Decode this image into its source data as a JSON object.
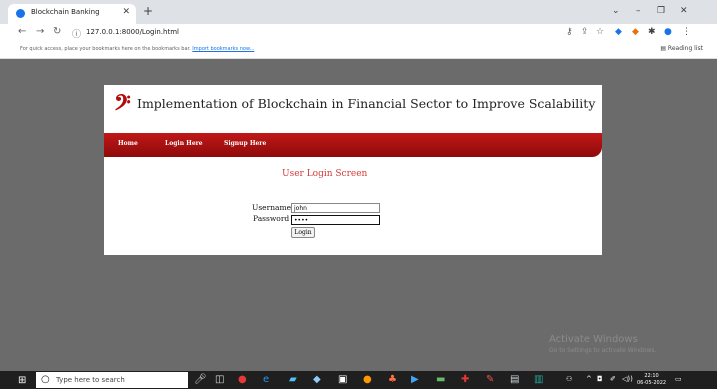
{
  "browser": {
    "tab_title": "Blockchain Banking",
    "url": "127.0.0.1:8000/Login.html",
    "bookmarks_prompt": "For quick access, place your bookmarks here on the bookmarks bar.",
    "bookmarks_link": "Import bookmarks now...",
    "reading_list": "Reading list"
  },
  "site": {
    "title": "Implementation of Blockchain in Financial Sector to Improve Scalability",
    "nav": [
      {
        "label": "Home"
      },
      {
        "label": "Login Here"
      },
      {
        "label": "Signup Here"
      }
    ]
  },
  "login": {
    "heading": "User Login Screen",
    "username_label": "Username",
    "username_value": "john",
    "password_label": "Password",
    "password_value": "john",
    "button_label": "Login"
  },
  "watermark": {
    "line1": "Activate Windows",
    "line2": "Go to Settings to activate Windows."
  },
  "taskbar": {
    "search_placeholder": "Type here to search",
    "time": "22:10",
    "date": "06-05-2022"
  }
}
